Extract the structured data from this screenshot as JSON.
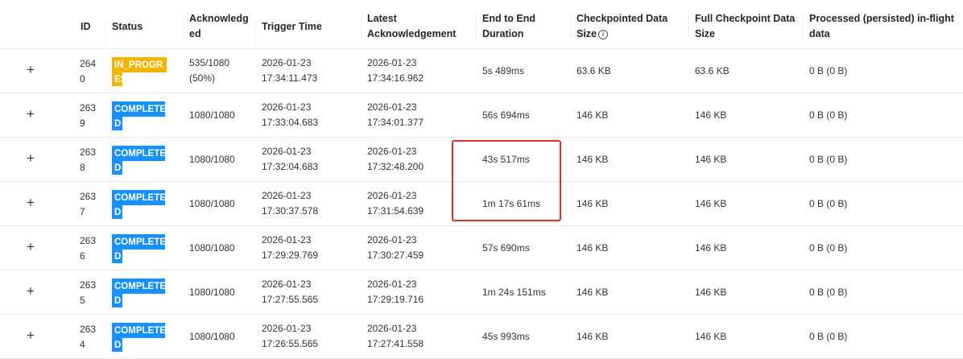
{
  "columns": {
    "id": "ID",
    "status": "Status",
    "acknowledged_l1": "Acknowledg",
    "acknowledged_l2": "ed",
    "trigger_time": "Trigger Time",
    "latest_ack_l1": "Latest",
    "latest_ack_l2": "Acknowledgement",
    "e2e_l1": "End to End",
    "e2e_l2": "Duration",
    "cp_size_l1": "Checkpointed Data",
    "cp_size_l2": "Size",
    "full_cp_l1": "Full Checkpoint Data",
    "full_cp_l2": "Size",
    "processed_l1": "Processed (persisted) in-flight",
    "processed_l2": "data"
  },
  "expand_symbol": "+",
  "info_symbol": "i",
  "colors": {
    "in_progress": "#f5b400",
    "completed": "#1890ff",
    "highlight": "#e02d2d"
  },
  "rows": [
    {
      "id_l1": "264",
      "id_l2": "0",
      "status": "IN_PROGRESS",
      "status_kind": "in_progress",
      "ack_l1": "535/1080",
      "ack_l2": "(50%)",
      "trigger_date": "2026-01-23",
      "trigger_time": "17:34:11.473",
      "latest_date": "2026-01-23",
      "latest_time": "17:34:16.962",
      "duration": "5s 489ms",
      "cp_size": "63.6 KB",
      "full_size": "63.6 KB",
      "processed": "0 B (0 B)"
    },
    {
      "id_l1": "263",
      "id_l2": "9",
      "status": "COMPLETED",
      "status_kind": "completed",
      "ack_l1": "1080/1080",
      "ack_l2": "",
      "trigger_date": "2026-01-23",
      "trigger_time": "17:33:04.683",
      "latest_date": "2026-01-23",
      "latest_time": "17:34:01.377",
      "duration": "56s 694ms",
      "cp_size": "146 KB",
      "full_size": "146 KB",
      "processed": "0 B (0 B)"
    },
    {
      "id_l1": "263",
      "id_l2": "8",
      "status": "COMPLETED",
      "status_kind": "completed",
      "ack_l1": "1080/1080",
      "ack_l2": "",
      "trigger_date": "2026-01-23",
      "trigger_time": "17:32:04.683",
      "latest_date": "2026-01-23",
      "latest_time": "17:32:48.200",
      "duration": "43s 517ms",
      "cp_size": "146 KB",
      "full_size": "146 KB",
      "processed": "0 B (0 B)"
    },
    {
      "id_l1": "263",
      "id_l2": "7",
      "status": "COMPLETED",
      "status_kind": "completed",
      "ack_l1": "1080/1080",
      "ack_l2": "",
      "trigger_date": "2026-01-23",
      "trigger_time": "17:30:37.578",
      "latest_date": "2026-01-23",
      "latest_time": "17:31:54.639",
      "duration": "1m 17s 61ms",
      "cp_size": "146 KB",
      "full_size": "146 KB",
      "processed": "0 B (0 B)"
    },
    {
      "id_l1": "263",
      "id_l2": "6",
      "status": "COMPLETED",
      "status_kind": "completed",
      "ack_l1": "1080/1080",
      "ack_l2": "",
      "trigger_date": "2026-01-23",
      "trigger_time": "17:29:29.769",
      "latest_date": "2026-01-23",
      "latest_time": "17:30:27.459",
      "duration": "57s 690ms",
      "cp_size": "146 KB",
      "full_size": "146 KB",
      "processed": "0 B (0 B)"
    },
    {
      "id_l1": "263",
      "id_l2": "5",
      "status": "COMPLETED",
      "status_kind": "completed",
      "ack_l1": "1080/1080",
      "ack_l2": "",
      "trigger_date": "2026-01-23",
      "trigger_time": "17:27:55.565",
      "latest_date": "2026-01-23",
      "latest_time": "17:29:19.716",
      "duration": "1m 24s 151ms",
      "cp_size": "146 KB",
      "full_size": "146 KB",
      "processed": "0 B (0 B)"
    },
    {
      "id_l1": "263",
      "id_l2": "4",
      "status": "COMPLETED",
      "status_kind": "completed",
      "ack_l1": "1080/1080",
      "ack_l2": "",
      "trigger_date": "2026-01-23",
      "trigger_time": "17:26:55.565",
      "latest_date": "2026-01-23",
      "latest_time": "17:27:41.558",
      "duration": "45s 993ms",
      "cp_size": "146 KB",
      "full_size": "146 KB",
      "processed": "0 B (0 B)"
    }
  ]
}
